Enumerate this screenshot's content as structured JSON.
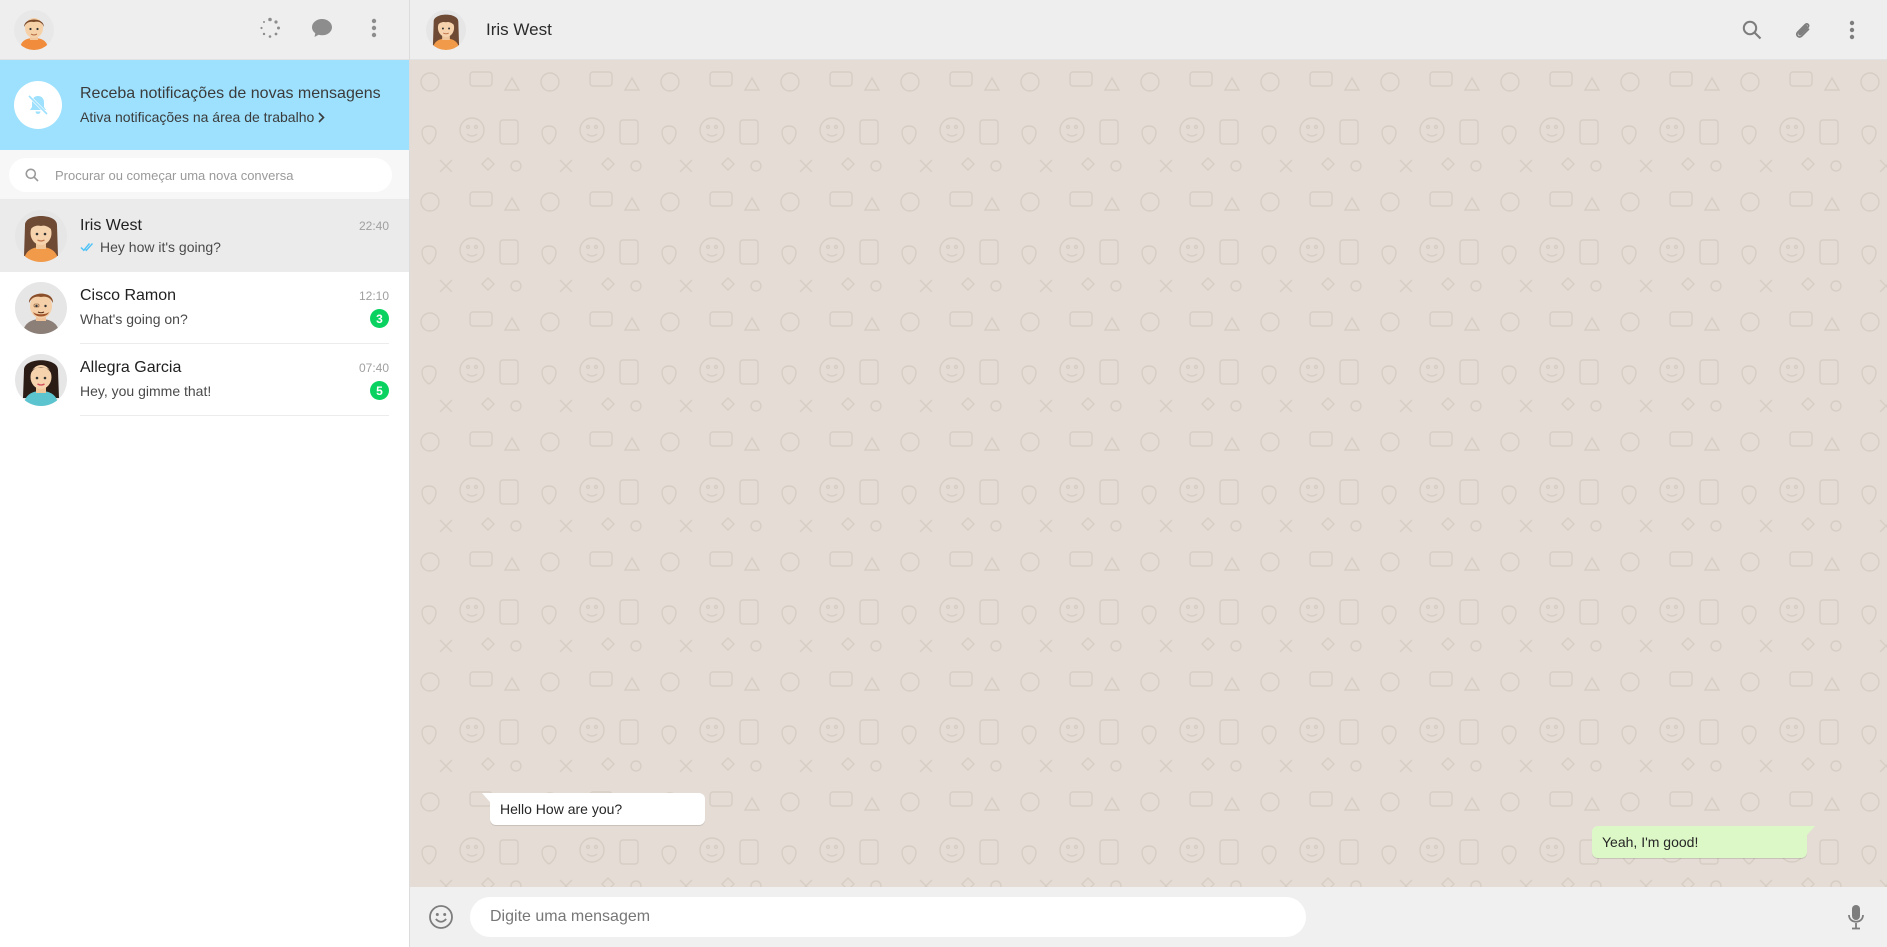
{
  "sidebar": {
    "notification": {
      "title": "Receba notificações de novas mensagens",
      "link": "Ativa notificações na área de trabalho"
    },
    "search": {
      "placeholder": "Procurar ou começar uma nova conversa"
    },
    "chats": [
      {
        "name": "Iris West",
        "time": "22:40",
        "preview": "Hey how it's going?",
        "read_ticks": true,
        "unread": null,
        "active": true
      },
      {
        "name": "Cisco Ramon",
        "time": "12:10",
        "preview": "What's going on?",
        "read_ticks": false,
        "unread": "3",
        "active": false
      },
      {
        "name": "Allegra Garcia",
        "time": "07:40",
        "preview": "Hey, you gimme that!",
        "read_ticks": false,
        "unread": "5",
        "active": false
      }
    ]
  },
  "main": {
    "contact_name": "Iris West",
    "messages": [
      {
        "direction": "in",
        "text": "Hello How are you?"
      },
      {
        "direction": "out",
        "text": "Yeah, I'm good!"
      }
    ],
    "composer": {
      "placeholder": "Digite uma mensagem"
    }
  },
  "colors": {
    "notification_bg": "#9de1fe",
    "unread_badge": "#09d261",
    "outgoing_bubble": "#dcf8c6",
    "wallpaper": "#e5ddd5",
    "read_ticks": "#4fc3f7"
  },
  "icons": [
    "status-icon",
    "new-chat-icon",
    "menu-icon",
    "bell-off-icon",
    "search-icon",
    "attach-icon",
    "emoji-icon",
    "mic-icon",
    "double-check-icon",
    "chevron-right-icon"
  ]
}
